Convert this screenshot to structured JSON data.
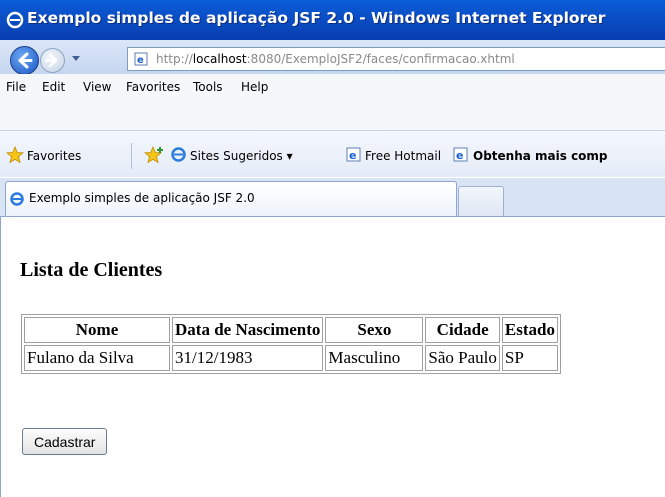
{
  "window": {
    "title": "Exemplo simples de aplicação JSF 2.0 - Windows Internet Explorer"
  },
  "address_bar": {
    "url_prefix": "http://",
    "url_host": "localhost",
    "url_rest": ":8080/ExemploJSF2/faces/confirmacao.xhtml"
  },
  "menu": {
    "items": [
      "File",
      "Edit",
      "View",
      "Favorites",
      "Tools",
      "Help"
    ]
  },
  "favorites_bar": {
    "favorites_label": "Favorites",
    "sites_sugeridos": "Sites Sugeridos ▾",
    "free_hotmail": "Free Hotmail",
    "obtenha": "Obtenha mais comp"
  },
  "tab": {
    "title": "Exemplo simples de aplicação JSF 2.0"
  },
  "page": {
    "heading": "Lista de Clientes",
    "table": {
      "headers": [
        "Nome",
        "Data de Nascimento",
        "Sexo",
        "Cidade",
        "Estado"
      ],
      "rows": [
        [
          "Fulano da Silva",
          "31/12/1983",
          "Masculino",
          "São Paulo",
          "SP"
        ]
      ]
    },
    "button_label": "Cadastrar"
  },
  "colors": {
    "titlebar": "#0a4fc8",
    "title_text": "#ffffff"
  }
}
